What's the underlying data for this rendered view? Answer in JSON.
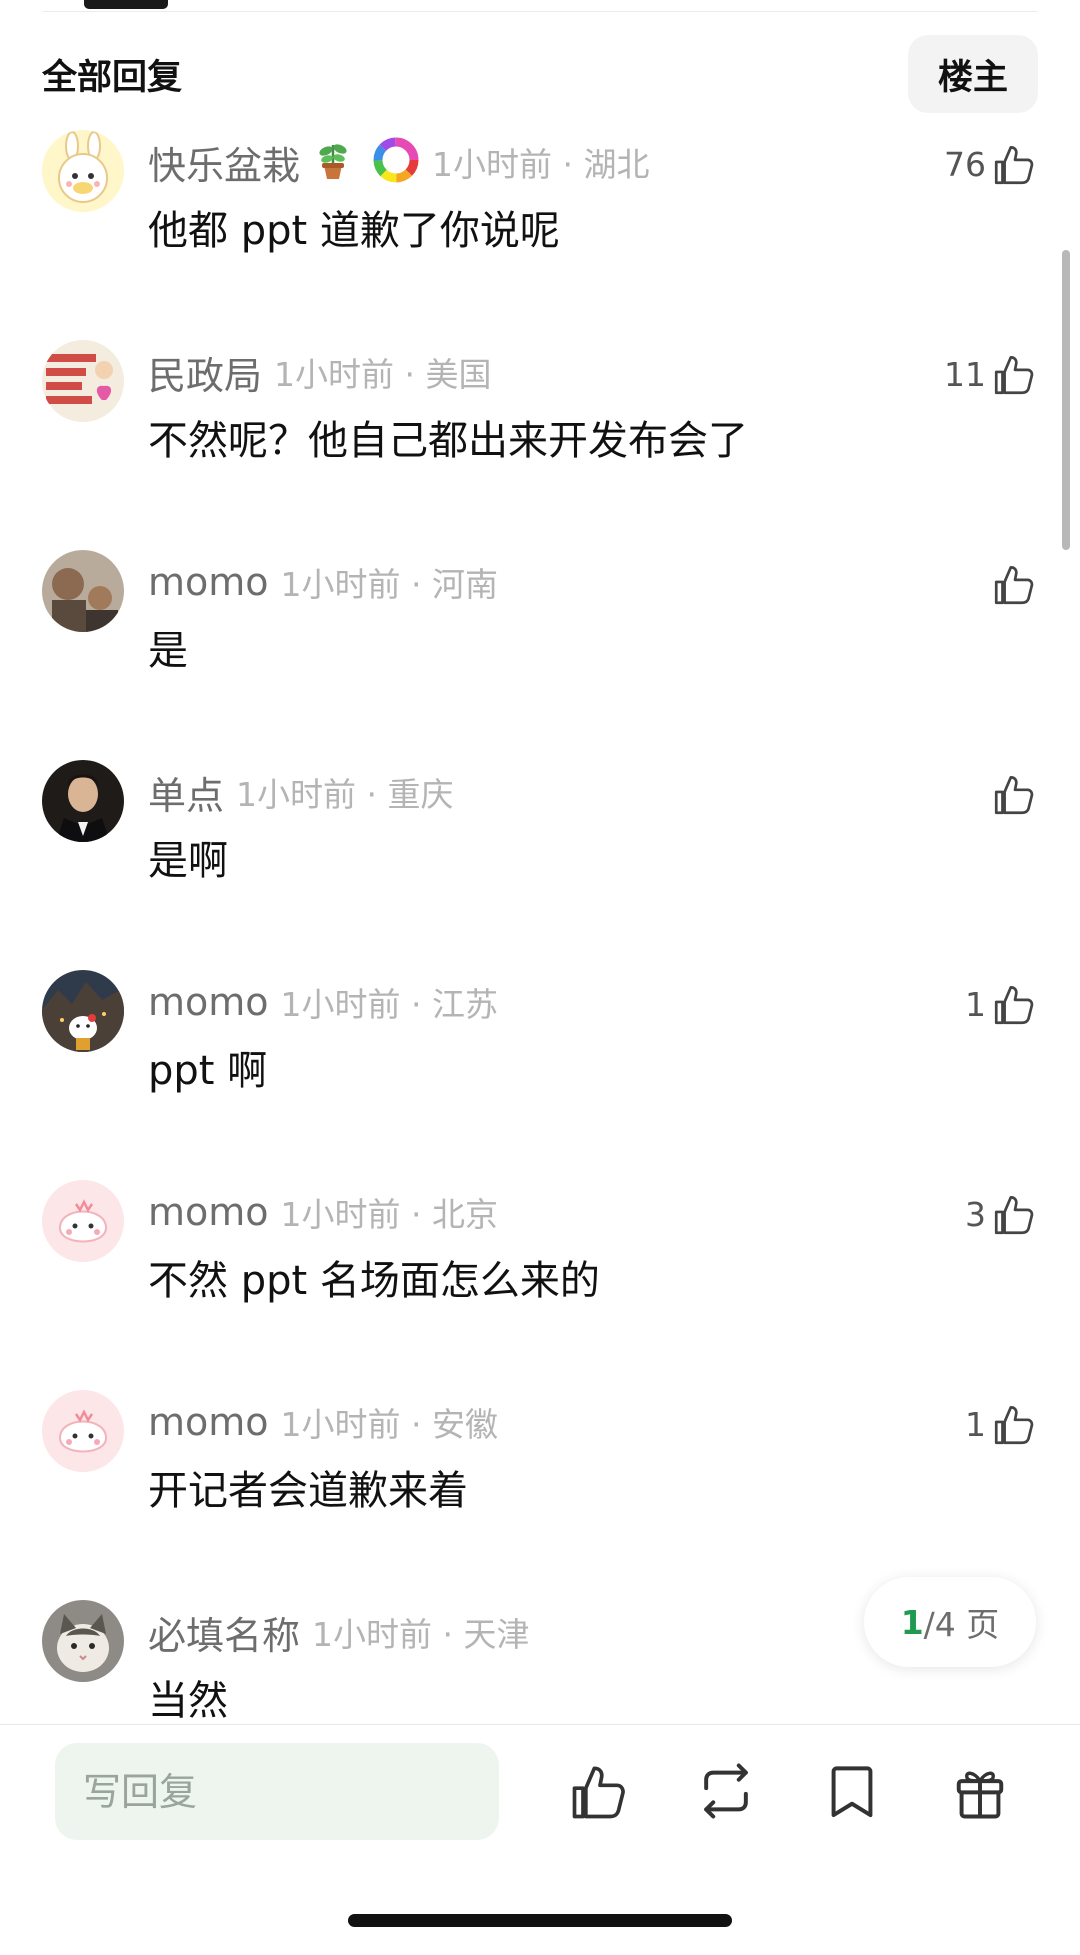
{
  "header": {
    "title": "全部回复",
    "op_filter": "楼主"
  },
  "comments": [
    {
      "username": "快乐盆栽",
      "badge": "🪴",
      "time_loc": "1小时前 · 湖北",
      "text": "他都 ppt 道歉了你说呢",
      "likes": "76",
      "avatar_color": "#fff6c9"
    },
    {
      "username": "民政局",
      "time_loc": "1小时前 · 美国",
      "text": "不然呢？他自己都出来开发布会了",
      "likes": "11",
      "avatar_color": "#f4ecdf"
    },
    {
      "username": "momo",
      "time_loc": "1小时前 · 河南",
      "text": "是",
      "likes": "",
      "avatar_color": "#8c7a68"
    },
    {
      "username": "单点",
      "time_loc": "1小时前 · 重庆",
      "text": "是啊",
      "likes": "",
      "avatar_color": "#2b2522"
    },
    {
      "username": "momo",
      "time_loc": "1小时前 · 江苏",
      "text": "ppt 啊",
      "likes": "1",
      "avatar_color": "#3c3a34"
    },
    {
      "username": "momo",
      "time_loc": "1小时前 · 北京",
      "text": "不然 ppt 名场面怎么来的",
      "likes": "3",
      "avatar_color": "#fde6e8"
    },
    {
      "username": "momo",
      "time_loc": "1小时前 · 安徽",
      "text": "开记者会道歉来着",
      "likes": "1",
      "avatar_color": "#fde6e8"
    },
    {
      "username": "必填名称",
      "time_loc": "1小时前 · 天津",
      "text": "当然",
      "likes": "",
      "avatar_color": "#8e8b86"
    }
  ],
  "pager": {
    "current": "1",
    "total": "/4 页"
  },
  "bottom_bar": {
    "reply_placeholder": "写回复",
    "icons": [
      "thumbs-up-icon",
      "repost-icon",
      "bookmark-icon",
      "gift-icon"
    ]
  },
  "colors": {
    "accent": "#1e9b4f",
    "input_bg": "#eef5ef"
  }
}
